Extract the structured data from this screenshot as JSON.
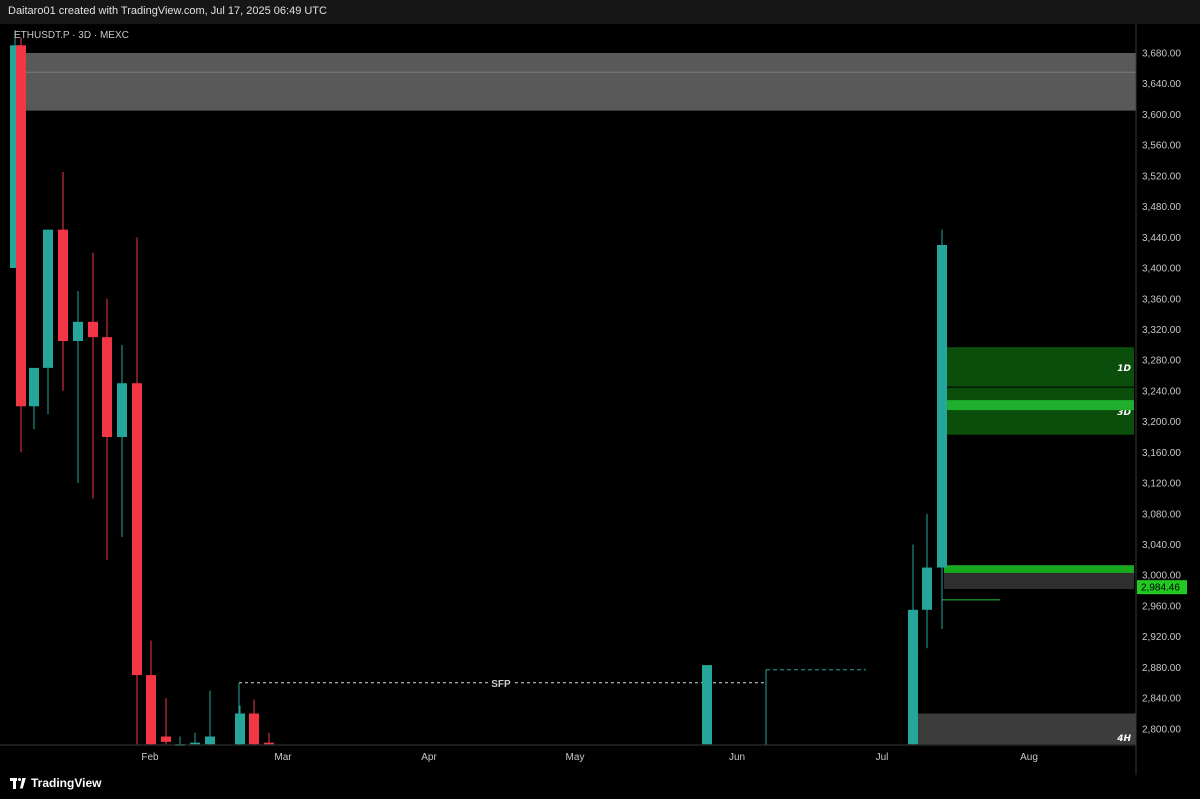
{
  "header": {
    "caption": "Daitaro01 created with TradingView.com, Jul 17, 2025 06:49 UTC"
  },
  "symbol_line": "ETHUSDT.P · 3D · MEXC",
  "brand": {
    "name": "TradingView"
  },
  "colors": {
    "up": "#26a69a",
    "down": "#f23645",
    "bg": "#000000",
    "zone_green": "#0b4d0b",
    "zone_bright": "#1fae2e",
    "price_tag": "#22c922"
  },
  "chart_data": {
    "type": "candlestick",
    "y_ticks": [
      "3,680.00",
      "3,640.00",
      "3,600.00",
      "3,560.00",
      "3,520.00",
      "3,480.00",
      "3,440.00",
      "3,400.00",
      "3,360.00",
      "3,320.00",
      "3,280.00",
      "3,240.00",
      "3,200.00",
      "3,160.00",
      "3,120.00",
      "3,080.00",
      "3,040.00",
      "3,000.00",
      "2,960.00",
      "2,920.00",
      "2,880.00",
      "2,840.00",
      "2,800.00"
    ],
    "ylim": [
      2780,
      3700
    ],
    "x_ticks": [
      "Feb",
      "Mar",
      "Apr",
      "May",
      "Jun",
      "Jul",
      "Aug"
    ],
    "current_price": 2984.46,
    "current_price_label": "2,984.46",
    "candles": [
      {
        "o": 3400,
        "h": 3710,
        "l": 3590,
        "c": 3690
      },
      {
        "o": 3690,
        "h": 3700,
        "l": 3160,
        "c": 3220
      },
      {
        "o": 3220,
        "h": 3260,
        "l": 3190,
        "c": 3270
      },
      {
        "o": 3270,
        "h": 3330,
        "l": 3210,
        "c": 3450
      },
      {
        "o": 3450,
        "h": 3525,
        "l": 3240,
        "c": 3305
      },
      {
        "o": 3305,
        "h": 3370,
        "l": 3120,
        "c": 3330
      },
      {
        "o": 3330,
        "h": 3420,
        "l": 3100,
        "c": 3310
      },
      {
        "o": 3310,
        "h": 3360,
        "l": 3020,
        "c": 3180
      },
      {
        "o": 3180,
        "h": 3300,
        "l": 3050,
        "c": 3250
      },
      {
        "o": 3250,
        "h": 3440,
        "l": 2780,
        "c": 2870
      },
      {
        "o": 2870,
        "h": 2915,
        "l": 2780,
        "c": 2780
      },
      {
        "o": 2790,
        "h": 2840,
        "l": 2780,
        "c": 2783
      },
      {
        "o": 2780,
        "h": 2790,
        "l": 2780,
        "c": 2780
      },
      {
        "o": 2780,
        "h": 2795,
        "l": 2780,
        "c": 2782
      },
      {
        "o": 2780,
        "h": 2850,
        "l": 2780,
        "c": 2790
      },
      {
        "o": 2780,
        "h": 2830,
        "l": 2780,
        "c": 2820
      },
      {
        "o": 2820,
        "h": 2838,
        "l": 2780,
        "c": 2780
      },
      {
        "o": 2782,
        "h": 2795,
        "l": 2780,
        "c": 2780
      },
      {
        "o": 2780,
        "h": 2860,
        "l": 2780,
        "c": 2883
      },
      {
        "o": 2780,
        "h": 3040,
        "l": 2780,
        "c": 2955
      },
      {
        "o": 2955,
        "h": 3080,
        "l": 2905,
        "c": 3010
      },
      {
        "o": 3010,
        "h": 3450,
        "l": 2930,
        "c": 3430
      }
    ],
    "levels": [
      {
        "label": "SFP",
        "value": 2860
      },
      {
        "label": "",
        "value": 2877
      }
    ],
    "zones": [
      {
        "label": "",
        "top": 3680,
        "bottom": 3605
      },
      {
        "label": "1D",
        "top": 3297,
        "bottom": 3245
      },
      {
        "label": "3D",
        "top": 3245,
        "bottom": 3183
      },
      {
        "label": "",
        "top": 3013,
        "bottom": 2982
      },
      {
        "label": "4H",
        "top": 2820,
        "bottom": 2780
      }
    ]
  }
}
